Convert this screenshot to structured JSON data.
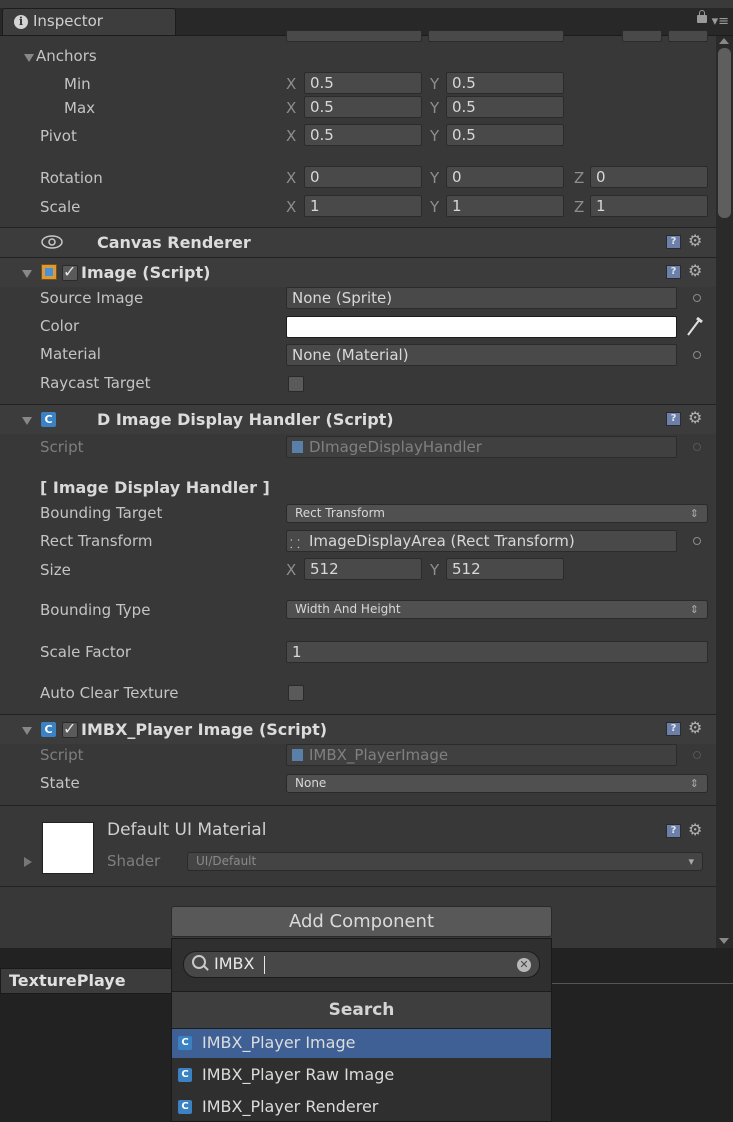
{
  "inspector": {
    "tab_title": "Inspector",
    "info_glyph": "i",
    "menu_glyph": "▾≡"
  },
  "rect_transform": {
    "anchors_label": "Anchors",
    "min_label": "Min",
    "max_label": "Max",
    "pivot_label": "Pivot",
    "rotation_label": "Rotation",
    "scale_label": "Scale",
    "x": "X",
    "y": "Y",
    "z": "Z",
    "anchor_min_x": "0.5",
    "anchor_min_y": "0.5",
    "anchor_max_x": "0.5",
    "anchor_max_y": "0.5",
    "pivot_x": "0.5",
    "pivot_y": "0.5",
    "rot_x": "0",
    "rot_y": "0",
    "rot_z": "0",
    "scale_x": "1",
    "scale_y": "1",
    "scale_z": "1"
  },
  "canvas_renderer": {
    "title": "Canvas Renderer"
  },
  "image_component": {
    "title": "Image (Script)",
    "source_image_label": "Source Image",
    "source_image_value": "None (Sprite)",
    "color_label": "Color",
    "color_value": "#ffffff",
    "material_label": "Material",
    "material_value": "None (Material)",
    "raycast_label": "Raycast Target",
    "raycast_checked": false
  },
  "d_image_handler": {
    "title": "D Image Display Handler (Script)",
    "script_label": "Script",
    "script_value": "DImageDisplayHandler",
    "section_header": "[ Image Display Handler ]",
    "bounding_target_label": "Bounding Target",
    "bounding_target_value": "Rect Transform",
    "rect_transform_label": "Rect Transform",
    "rect_transform_value": "ImageDisplayArea (Rect Transform)",
    "size_label": "Size",
    "size_x": "512",
    "size_y": "512",
    "bounding_type_label": "Bounding Type",
    "bounding_type_value": "Width And Height",
    "scale_factor_label": "Scale Factor",
    "scale_factor_value": "1",
    "auto_clear_label": "Auto Clear Texture",
    "auto_clear_checked": false
  },
  "imbx_player_image": {
    "title": "IMBX_Player Image (Script)",
    "script_label": "Script",
    "script_value": "IMBX_PlayerImage",
    "state_label": "State",
    "state_value": "None"
  },
  "material": {
    "name": "Default UI Material",
    "shader_label": "Shader",
    "shader_value": "UI/Default"
  },
  "add_component": {
    "button_label": "Add Component",
    "search_value": "IMBX",
    "dropdown_title": "Search",
    "results": [
      {
        "label": "IMBX_Player Image",
        "selected": true
      },
      {
        "label": "IMBX_Player Raw Image",
        "selected": false
      },
      {
        "label": "IMBX_Player Renderer",
        "selected": false
      }
    ]
  },
  "bottom_panel": {
    "tab_title": "TexturePlaye"
  },
  "colors": {
    "panel_bg": "#383838",
    "selection": "#3e6095",
    "script_icon": "#3a82c4"
  },
  "icons": [
    "info-icon",
    "lock-icon",
    "tab-menu-icon",
    "eye-icon",
    "help-icon",
    "gear-icon",
    "csharp-script-icon",
    "image-component-icon",
    "object-picker-icon",
    "eyedropper-icon",
    "search-icon",
    "clear-search-icon"
  ]
}
